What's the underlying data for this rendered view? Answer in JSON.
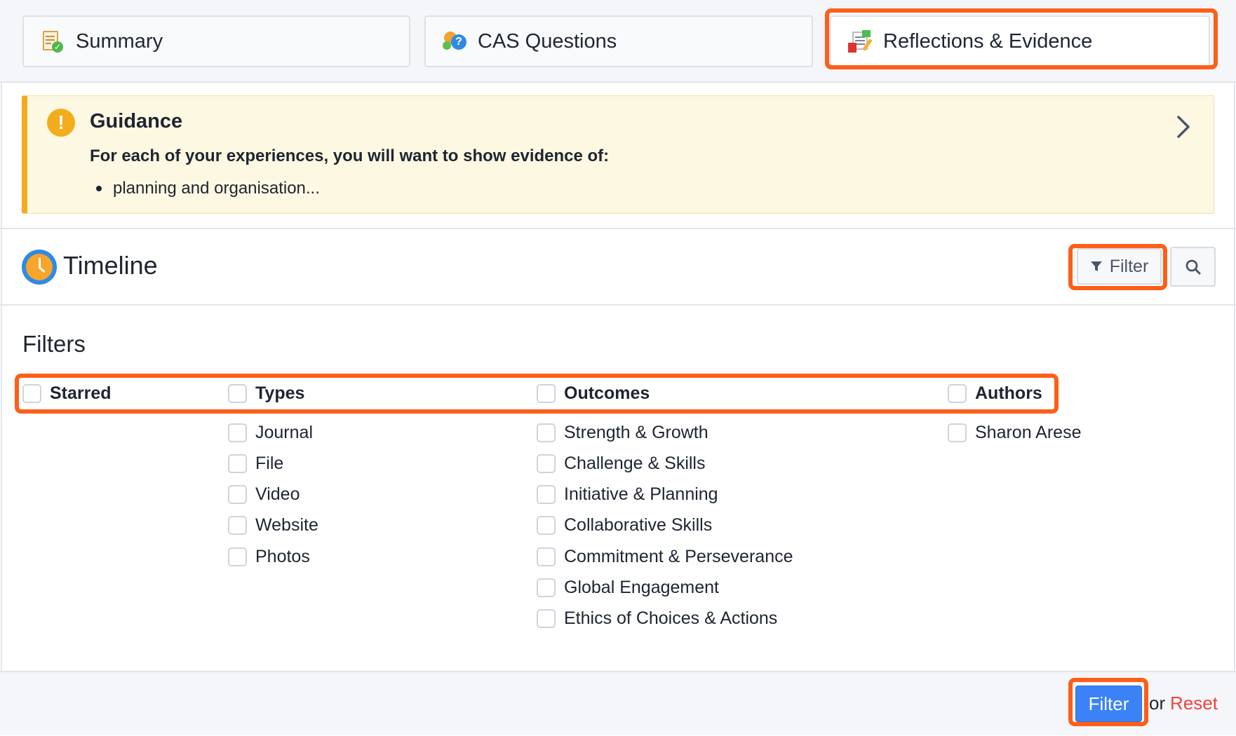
{
  "tabs": [
    {
      "label": "Summary",
      "icon": "summary-icon"
    },
    {
      "label": "CAS Questions",
      "icon": "cas-questions-icon"
    },
    {
      "label": "Reflections & Evidence",
      "icon": "reflections-icon"
    }
  ],
  "guidance": {
    "title": "Guidance",
    "text": "For each of your experiences, you will want to show evidence of:",
    "bullets": [
      "planning and organisation..."
    ]
  },
  "timeline": {
    "title": "Timeline",
    "filter_button": "Filter"
  },
  "filters": {
    "title": "Filters",
    "headers": {
      "starred": "Starred",
      "types": "Types",
      "outcomes": "Outcomes",
      "authors": "Authors"
    },
    "types": [
      "Journal",
      "File",
      "Video",
      "Website",
      "Photos"
    ],
    "outcomes": [
      "Strength & Growth",
      "Challenge & Skills",
      "Initiative & Planning",
      "Collaborative Skills",
      "Commitment & Perseverance",
      "Global Engagement",
      "Ethics of Choices & Actions"
    ],
    "authors": [
      "Sharon Arese"
    ]
  },
  "footer": {
    "apply_button": "Filter",
    "or_text": "or",
    "reset_link": "Reset"
  },
  "colors": {
    "highlight": "#fe5e18",
    "primary": "#3b82f6",
    "warning": "#f2ad1c",
    "reset": "#f0443d"
  }
}
